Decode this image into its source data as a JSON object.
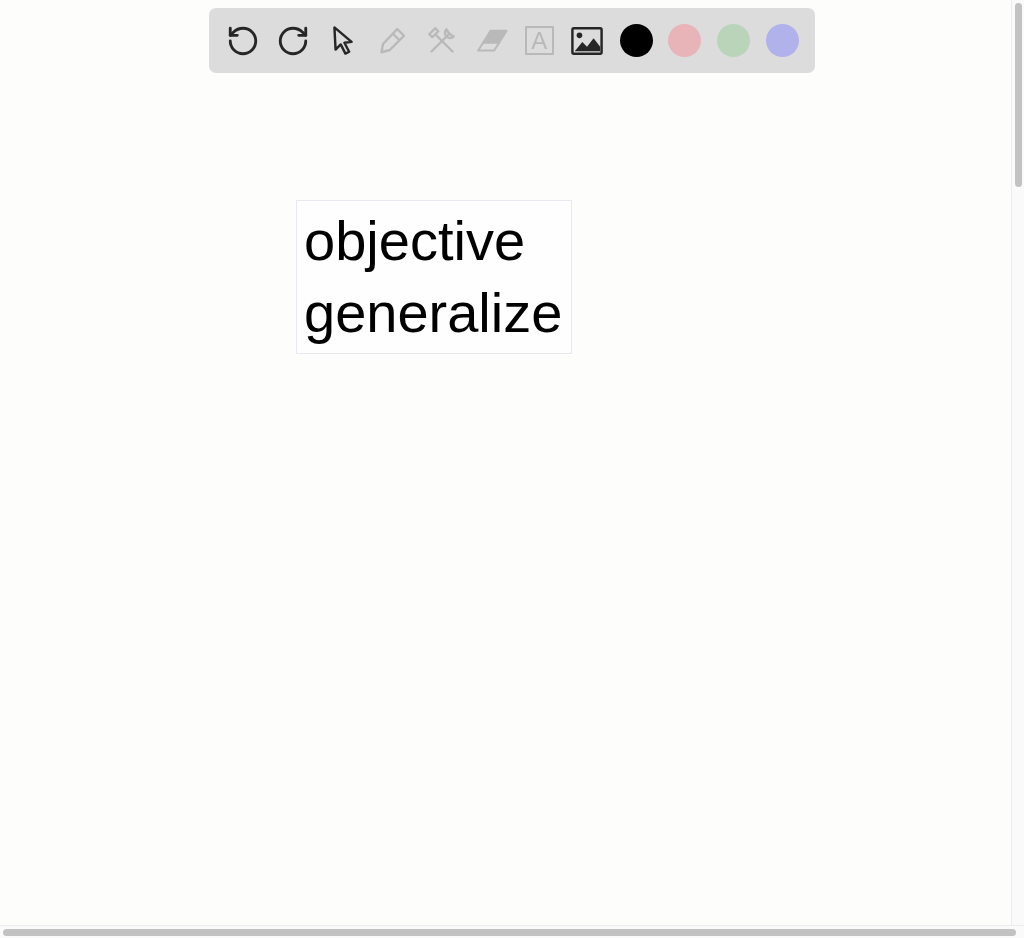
{
  "toolbar": {
    "tools": [
      {
        "kind": "undo",
        "disabled": false
      },
      {
        "kind": "redo",
        "disabled": false
      },
      {
        "kind": "select",
        "disabled": false
      },
      {
        "kind": "pencil",
        "disabled": true
      },
      {
        "kind": "tools",
        "disabled": true
      },
      {
        "kind": "eraser",
        "disabled": true
      },
      {
        "kind": "text",
        "disabled": true,
        "label": "A"
      },
      {
        "kind": "image",
        "disabled": false
      }
    ],
    "colors": [
      {
        "color": "#000000"
      },
      {
        "color": "#e8b4b7"
      },
      {
        "color": "#b9d4b9"
      },
      {
        "color": "#b1b1ec"
      }
    ]
  },
  "canvas": {
    "text_box": {
      "lines": [
        "objective",
        "generalize"
      ]
    }
  }
}
